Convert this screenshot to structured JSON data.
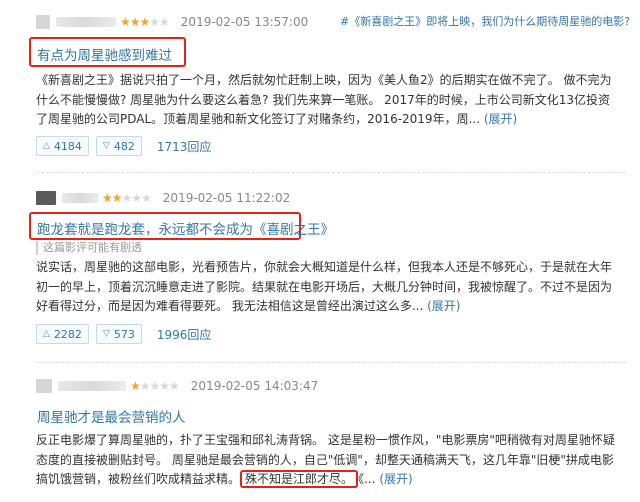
{
  "reviews": [
    {
      "rating": 3,
      "date": "2019-02-05 13:57:00",
      "topic": "#《新喜剧之王》即将上映，我们为什么期待周星驰的电影?",
      "title": "有点为周星驰感到难过",
      "body": "《新喜剧之王》据说只拍了一个月，然后就匆忙赶制上映，因为《美人鱼2》的后期实在做不完了。 做不完为什么不能慢慢做? 周星驰为什么要这么着急? 我们先来算一笔账。 2017年的时候，上市公司新文化13亿投资了周星驰的公司PDAL。顶着周星驰和新文化签订了对赌条约，2016-2019年，周...",
      "expand": "(展开)",
      "up": "4184",
      "down": "482",
      "replies": "1713回应"
    },
    {
      "rating": 2,
      "date": "2019-02-05 11:22:02",
      "title": "跑龙套就是跑龙套，永远都不会成为《喜剧之王》",
      "spoiler": "这篇影评可能有剧透",
      "body": "说实话，周星驰的这部电影，光看预告片，你就会大概知道是什么样，但我本人还是不够死心，于是就在大年初一的早上，顶着沉沉睡意走进了影院。结果就在电影开场后，大概几分钟时间，我被惊醒了。不过不是因为好看得过分，而是因为难看得要死。 我无法相信这是曾经出演过这么多...",
      "expand": "(展开)",
      "up": "2282",
      "down": "573",
      "replies": "1996回应"
    },
    {
      "rating": 1,
      "date": "2019-02-05 14:03:47",
      "title": "周星驰才是最会营销的人",
      "body": "反正电影爆了算周星驰的，扑了王宝强和邱礼涛背锅。 这是星粉一惯作风，\"电影票房\"吧稍微有对周星驰怀疑态度的直接被删贴封号。 周星驰是最会营销的人，自己\"低调\"，却整天通稿满天飞，这几年靠\"旧梗\"拼成电影搞饥饿营销，被粉丝们吹成精益求精。",
      "highlight": "殊不知是江郎才尽。",
      "tail": "《...",
      "expand": "(展开)"
    }
  ],
  "colors": {
    "link": "#3377aa",
    "star": "#f3a42a",
    "highlight_box": "#e52217"
  }
}
